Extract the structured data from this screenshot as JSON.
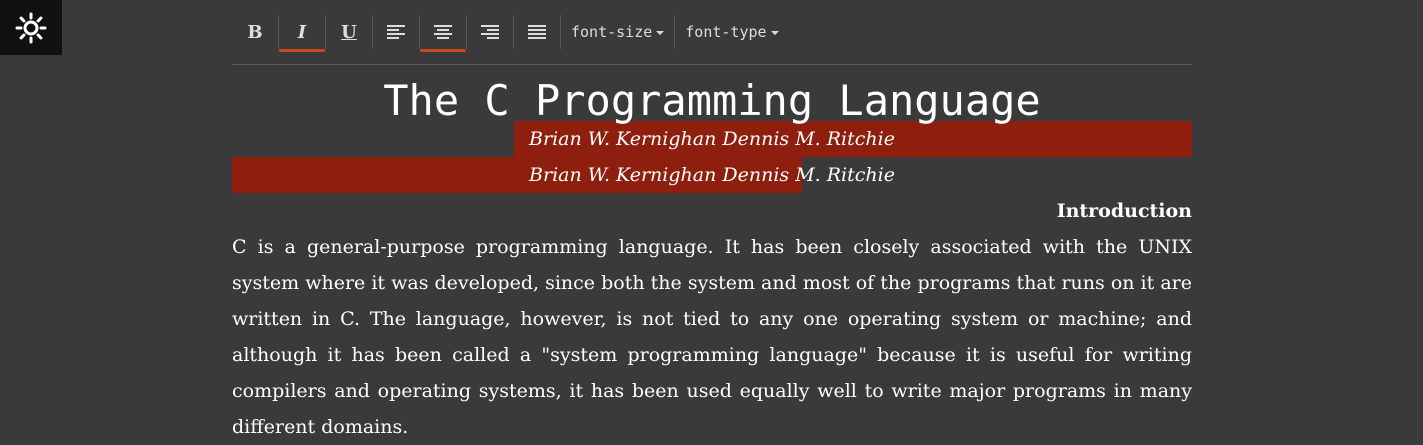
{
  "toolbar": {
    "bold_label": "B",
    "italic_label": "I",
    "underline_label": "U",
    "font_size_label": "font-size",
    "font_type_label": "font-type",
    "active_buttons": [
      "italic",
      "align-center"
    ]
  },
  "document": {
    "title": "The C Programming Language",
    "authors_line_1": "Brian W. Kernighan Dennis M. Ritchie",
    "authors_line_2": "Brian W. Kernighan Dennis M. Ritchie",
    "section_heading": "Introduction",
    "paragraph": "C is a general-purpose programming language. It has been closely associated with the UNIX system where it was developed, since both the system and most of the programs that runs on it are written in C. The language, however, is not tied to any one operating system or machine; and although it has been called a \"system programming language\" because it is useful for writing compilers and operating systems, it has been used equally well to write major programs in many different domains."
  },
  "colors": {
    "background": "#3a3a3a",
    "settings_button": "#111111",
    "highlight": "#8e1f0e",
    "active_underline": "#c8481e"
  },
  "icons": {
    "settings": "sun-gear-icon",
    "align_left": "align-left-icon",
    "align_center": "align-center-icon",
    "align_right": "align-right-icon",
    "justify": "justify-icon"
  }
}
